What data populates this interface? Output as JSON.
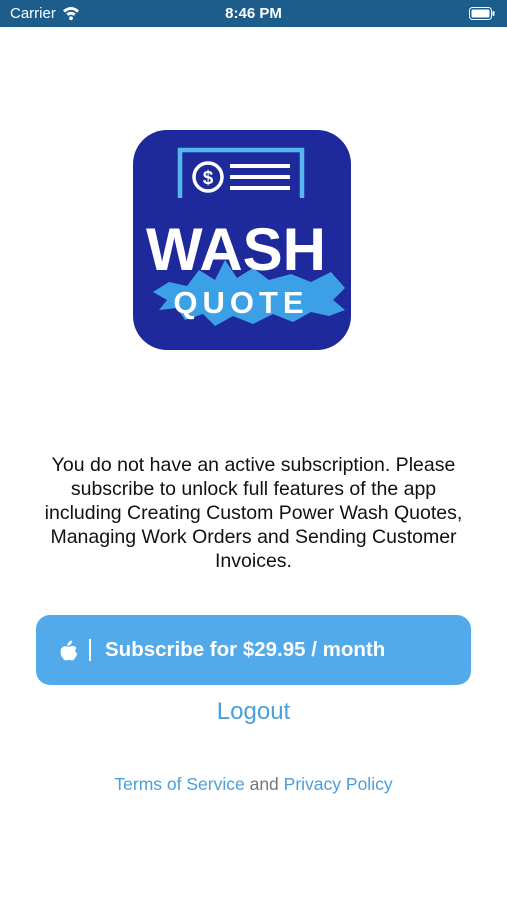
{
  "status_bar": {
    "carrier": "Carrier",
    "time": "8:46 PM",
    "icons": [
      "wifi-icon",
      "battery-icon"
    ]
  },
  "logo": {
    "line1": "WASH",
    "line2": "QUOTE",
    "icon": "dollar-receipt-icon"
  },
  "message": "You do not have an active subscription. Please subscribe to unlock full features of the app including Creating Custom Power Wash Quotes, Managing Work Orders and Sending Customer Invoices.",
  "subscribe_button": {
    "label": "Subscribe for $29.95 / month",
    "icon": "apple-icon"
  },
  "logout_label": "Logout",
  "legal": {
    "terms": "Terms of Service",
    "connector": "and",
    "privacy": "Privacy Policy"
  },
  "colors": {
    "status_bar": "#1c5d8c",
    "accent": "#52aaea",
    "link": "#4a9fdc",
    "logo_bg": "#1e2a9c",
    "splash": "#3ca0e6"
  }
}
